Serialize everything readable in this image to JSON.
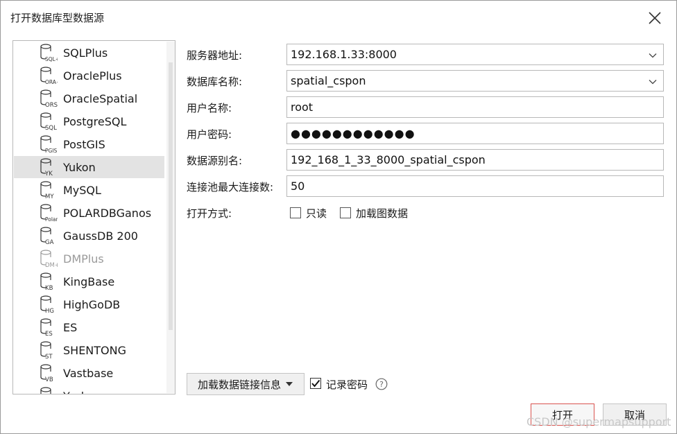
{
  "dialog": {
    "title": "打开数据库型数据源"
  },
  "db_list": {
    "items": [
      {
        "label": "SQLPlus",
        "icon_tag": "SQL+",
        "selected": false,
        "disabled": false
      },
      {
        "label": "OraclePlus",
        "icon_tag": "ORA+",
        "selected": false,
        "disabled": false
      },
      {
        "label": "OracleSpatial",
        "icon_tag": "ORS",
        "selected": false,
        "disabled": false
      },
      {
        "label": "PostgreSQL",
        "icon_tag": "SQL",
        "selected": false,
        "disabled": false
      },
      {
        "label": "PostGIS",
        "icon_tag": "PGIS",
        "selected": false,
        "disabled": false
      },
      {
        "label": "Yukon",
        "icon_tag": "YK",
        "selected": true,
        "disabled": false
      },
      {
        "label": "MySQL",
        "icon_tag": "MY",
        "selected": false,
        "disabled": false
      },
      {
        "label": "POLARDBGanos",
        "icon_tag": "Polar",
        "selected": false,
        "disabled": false
      },
      {
        "label": "GaussDB 200",
        "icon_tag": "GA",
        "selected": false,
        "disabled": false
      },
      {
        "label": "DMPlus",
        "icon_tag": "DM+",
        "selected": false,
        "disabled": true
      },
      {
        "label": "KingBase",
        "icon_tag": "KB",
        "selected": false,
        "disabled": false
      },
      {
        "label": "HighGoDB",
        "icon_tag": "HG",
        "selected": false,
        "disabled": false
      },
      {
        "label": "ES",
        "icon_tag": "ES",
        "selected": false,
        "disabled": false
      },
      {
        "label": "SHENTONG",
        "icon_tag": "ST",
        "selected": false,
        "disabled": false
      },
      {
        "label": "Vastbase",
        "icon_tag": "VB",
        "selected": false,
        "disabled": false
      },
      {
        "label": "Yashan",
        "icon_tag": "",
        "selected": false,
        "disabled": false
      }
    ]
  },
  "form": {
    "server_label": "服务器地址:",
    "server_value": "192.168.1.33:8000",
    "database_label": "数据库名称:",
    "database_value": "spatial_cspon",
    "user_label": "用户名称:",
    "user_value": "root",
    "password_label": "用户密码:",
    "password_value": "●●●●●●●●●●●●",
    "alias_label": "数据源别名:",
    "alias_value": "192_168_1_33_8000_spatial_cspon",
    "pool_label": "连接池最大连接数:",
    "pool_value": "50",
    "open_mode_label": "打开方式:",
    "readonly_label": "只读",
    "readonly_checked": false,
    "load_map_label": "加载图数据",
    "load_map_checked": false
  },
  "footer": {
    "load_link_label": "加载数据链接信息",
    "remember_label": "记录密码",
    "remember_checked": true,
    "open_label": "打开",
    "cancel_label": "取消"
  },
  "watermark": "CSDN @supermapsupport",
  "icons": {
    "close": "close-icon",
    "database": "database-icon",
    "dropdown": "chevron-down-icon",
    "help": "help-icon"
  },
  "colors": {
    "selected_row": "#e3e3e3",
    "primary_border": "#d9534f"
  }
}
